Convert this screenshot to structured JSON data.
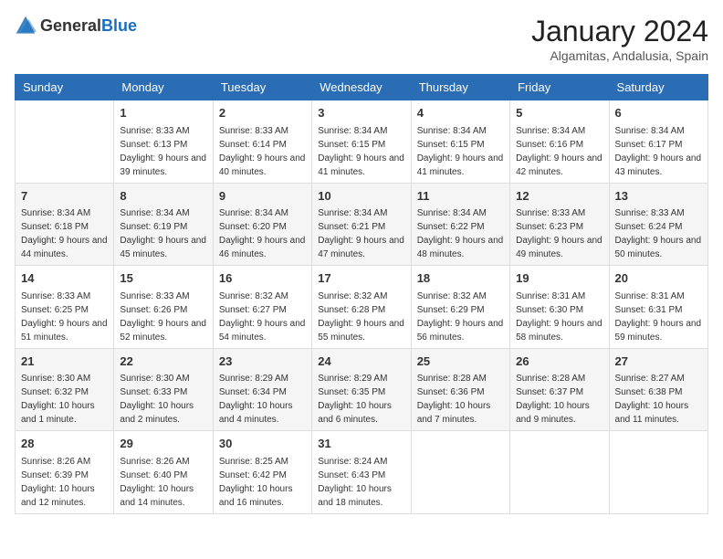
{
  "header": {
    "logo_general": "General",
    "logo_blue": "Blue",
    "month_year": "January 2024",
    "location": "Algamitas, Andalusia, Spain"
  },
  "columns": [
    "Sunday",
    "Monday",
    "Tuesday",
    "Wednesday",
    "Thursday",
    "Friday",
    "Saturday"
  ],
  "weeks": [
    [
      {
        "day": "",
        "sunrise": "",
        "sunset": "",
        "daylight": ""
      },
      {
        "day": "1",
        "sunrise": "Sunrise: 8:33 AM",
        "sunset": "Sunset: 6:13 PM",
        "daylight": "Daylight: 9 hours and 39 minutes."
      },
      {
        "day": "2",
        "sunrise": "Sunrise: 8:33 AM",
        "sunset": "Sunset: 6:14 PM",
        "daylight": "Daylight: 9 hours and 40 minutes."
      },
      {
        "day": "3",
        "sunrise": "Sunrise: 8:34 AM",
        "sunset": "Sunset: 6:15 PM",
        "daylight": "Daylight: 9 hours and 41 minutes."
      },
      {
        "day": "4",
        "sunrise": "Sunrise: 8:34 AM",
        "sunset": "Sunset: 6:15 PM",
        "daylight": "Daylight: 9 hours and 41 minutes."
      },
      {
        "day": "5",
        "sunrise": "Sunrise: 8:34 AM",
        "sunset": "Sunset: 6:16 PM",
        "daylight": "Daylight: 9 hours and 42 minutes."
      },
      {
        "day": "6",
        "sunrise": "Sunrise: 8:34 AM",
        "sunset": "Sunset: 6:17 PM",
        "daylight": "Daylight: 9 hours and 43 minutes."
      }
    ],
    [
      {
        "day": "7",
        "sunrise": "Sunrise: 8:34 AM",
        "sunset": "Sunset: 6:18 PM",
        "daylight": "Daylight: 9 hours and 44 minutes."
      },
      {
        "day": "8",
        "sunrise": "Sunrise: 8:34 AM",
        "sunset": "Sunset: 6:19 PM",
        "daylight": "Daylight: 9 hours and 45 minutes."
      },
      {
        "day": "9",
        "sunrise": "Sunrise: 8:34 AM",
        "sunset": "Sunset: 6:20 PM",
        "daylight": "Daylight: 9 hours and 46 minutes."
      },
      {
        "day": "10",
        "sunrise": "Sunrise: 8:34 AM",
        "sunset": "Sunset: 6:21 PM",
        "daylight": "Daylight: 9 hours and 47 minutes."
      },
      {
        "day": "11",
        "sunrise": "Sunrise: 8:34 AM",
        "sunset": "Sunset: 6:22 PM",
        "daylight": "Daylight: 9 hours and 48 minutes."
      },
      {
        "day": "12",
        "sunrise": "Sunrise: 8:33 AM",
        "sunset": "Sunset: 6:23 PM",
        "daylight": "Daylight: 9 hours and 49 minutes."
      },
      {
        "day": "13",
        "sunrise": "Sunrise: 8:33 AM",
        "sunset": "Sunset: 6:24 PM",
        "daylight": "Daylight: 9 hours and 50 minutes."
      }
    ],
    [
      {
        "day": "14",
        "sunrise": "Sunrise: 8:33 AM",
        "sunset": "Sunset: 6:25 PM",
        "daylight": "Daylight: 9 hours and 51 minutes."
      },
      {
        "day": "15",
        "sunrise": "Sunrise: 8:33 AM",
        "sunset": "Sunset: 6:26 PM",
        "daylight": "Daylight: 9 hours and 52 minutes."
      },
      {
        "day": "16",
        "sunrise": "Sunrise: 8:32 AM",
        "sunset": "Sunset: 6:27 PM",
        "daylight": "Daylight: 9 hours and 54 minutes."
      },
      {
        "day": "17",
        "sunrise": "Sunrise: 8:32 AM",
        "sunset": "Sunset: 6:28 PM",
        "daylight": "Daylight: 9 hours and 55 minutes."
      },
      {
        "day": "18",
        "sunrise": "Sunrise: 8:32 AM",
        "sunset": "Sunset: 6:29 PM",
        "daylight": "Daylight: 9 hours and 56 minutes."
      },
      {
        "day": "19",
        "sunrise": "Sunrise: 8:31 AM",
        "sunset": "Sunset: 6:30 PM",
        "daylight": "Daylight: 9 hours and 58 minutes."
      },
      {
        "day": "20",
        "sunrise": "Sunrise: 8:31 AM",
        "sunset": "Sunset: 6:31 PM",
        "daylight": "Daylight: 9 hours and 59 minutes."
      }
    ],
    [
      {
        "day": "21",
        "sunrise": "Sunrise: 8:30 AM",
        "sunset": "Sunset: 6:32 PM",
        "daylight": "Daylight: 10 hours and 1 minute."
      },
      {
        "day": "22",
        "sunrise": "Sunrise: 8:30 AM",
        "sunset": "Sunset: 6:33 PM",
        "daylight": "Daylight: 10 hours and 2 minutes."
      },
      {
        "day": "23",
        "sunrise": "Sunrise: 8:29 AM",
        "sunset": "Sunset: 6:34 PM",
        "daylight": "Daylight: 10 hours and 4 minutes."
      },
      {
        "day": "24",
        "sunrise": "Sunrise: 8:29 AM",
        "sunset": "Sunset: 6:35 PM",
        "daylight": "Daylight: 10 hours and 6 minutes."
      },
      {
        "day": "25",
        "sunrise": "Sunrise: 8:28 AM",
        "sunset": "Sunset: 6:36 PM",
        "daylight": "Daylight: 10 hours and 7 minutes."
      },
      {
        "day": "26",
        "sunrise": "Sunrise: 8:28 AM",
        "sunset": "Sunset: 6:37 PM",
        "daylight": "Daylight: 10 hours and 9 minutes."
      },
      {
        "day": "27",
        "sunrise": "Sunrise: 8:27 AM",
        "sunset": "Sunset: 6:38 PM",
        "daylight": "Daylight: 10 hours and 11 minutes."
      }
    ],
    [
      {
        "day": "28",
        "sunrise": "Sunrise: 8:26 AM",
        "sunset": "Sunset: 6:39 PM",
        "daylight": "Daylight: 10 hours and 12 minutes."
      },
      {
        "day": "29",
        "sunrise": "Sunrise: 8:26 AM",
        "sunset": "Sunset: 6:40 PM",
        "daylight": "Daylight: 10 hours and 14 minutes."
      },
      {
        "day": "30",
        "sunrise": "Sunrise: 8:25 AM",
        "sunset": "Sunset: 6:42 PM",
        "daylight": "Daylight: 10 hours and 16 minutes."
      },
      {
        "day": "31",
        "sunrise": "Sunrise: 8:24 AM",
        "sunset": "Sunset: 6:43 PM",
        "daylight": "Daylight: 10 hours and 18 minutes."
      },
      {
        "day": "",
        "sunrise": "",
        "sunset": "",
        "daylight": ""
      },
      {
        "day": "",
        "sunrise": "",
        "sunset": "",
        "daylight": ""
      },
      {
        "day": "",
        "sunrise": "",
        "sunset": "",
        "daylight": ""
      }
    ]
  ]
}
